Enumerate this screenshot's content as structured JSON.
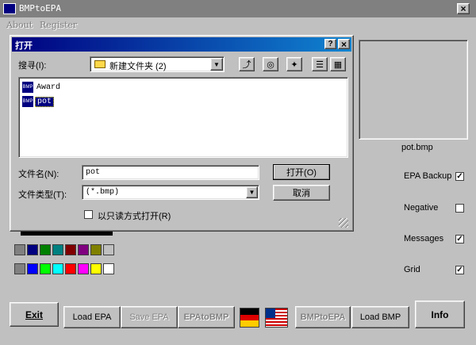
{
  "app": {
    "title": "BMPtoEPA"
  },
  "menu": {
    "about": "About",
    "register": "Register"
  },
  "preview": {
    "filename": "pot.bmp"
  },
  "options": {
    "epa_backup": {
      "label": "EPA Backup",
      "checked": "✓"
    },
    "negative": {
      "label": "Negative",
      "checked": ""
    },
    "messages": {
      "label": "Messages",
      "checked": "✓"
    },
    "grid": {
      "label": "Grid",
      "checked": "✓"
    }
  },
  "palette": {
    "row1": [
      "#808080",
      "#000080",
      "#008000",
      "#008080",
      "#800000",
      "#800080",
      "#808000",
      "#c0c0c0"
    ],
    "row2": [
      "#808080",
      "#0000ff",
      "#00ff00",
      "#00ffff",
      "#ff0000",
      "#ff00ff",
      "#ffff00",
      "#ffffff"
    ]
  },
  "buttons": {
    "exit": "Exit",
    "load_epa": "Load EPA",
    "save_epa": "Save EPA",
    "epa_to_bmp": "EPAtoBMP",
    "bmp_to_epa": "BMPtoEPA",
    "load_bmp": "Load BMP",
    "info": "Info"
  },
  "dialog": {
    "title": "打开",
    "help_btn": "?",
    "close_btn": "×",
    "lookin_label": "搜寻(I):",
    "lookin_value": "新建文件夹 (2)",
    "files": [
      {
        "name": "Award",
        "icon": "BMP"
      },
      {
        "name": "pot",
        "icon": "BMP"
      }
    ],
    "filename_label": "文件名(N):",
    "filename_value": "pot",
    "filetype_label": "文件类型(T):",
    "filetype_value": "(*.bmp)",
    "open_btn": "打开(O)",
    "cancel_btn": "取消",
    "readonly_label": "以只读方式打开(R)"
  }
}
